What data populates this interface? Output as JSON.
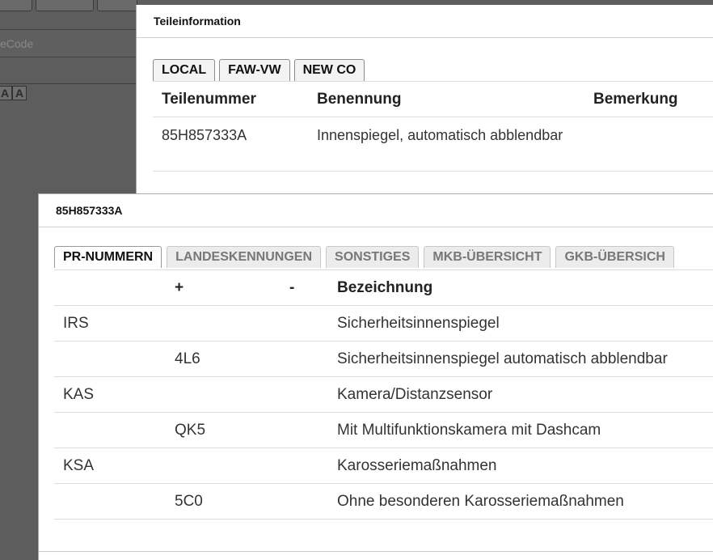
{
  "background": {
    "tabs": [
      "",
      "",
      "",
      "",
      "",
      ""
    ],
    "input_placeholder": "eCode",
    "font_increase": "A",
    "font_decrease": "A"
  },
  "dialog1": {
    "title": "Teileinformation",
    "tabs": [
      "LOCAL",
      "FAW-VW",
      "NEW CO"
    ],
    "columns": [
      "Teilenummer",
      "Benennung",
      "Bemerkung"
    ],
    "rows": [
      {
        "teilenummer": "85H857333A",
        "benennung": "Innenspiegel, automatisch abblendbar",
        "bemerkung": ""
      }
    ]
  },
  "dialog2": {
    "title": "85H857333A",
    "tabs": [
      "PR-NUMMERN",
      "LANDESKENNUNGEN",
      "SONSTIGES",
      "MKB-ÜBERSICHT",
      "GKB-ÜBERSICH"
    ],
    "columns": [
      "",
      "+",
      "-",
      "Bezeichnung"
    ],
    "rows": [
      {
        "group": "IRS",
        "plus": "",
        "minus": "",
        "bezeichnung": "Sicherheitsinnenspiegel"
      },
      {
        "group": "",
        "plus": "4L6",
        "minus": "",
        "bezeichnung": "Sicherheitsinnenspiegel automatisch abblendbar"
      },
      {
        "group": "KAS",
        "plus": "",
        "minus": "",
        "bezeichnung": "Kamera/Distanzsensor"
      },
      {
        "group": "",
        "plus": "QK5",
        "minus": "",
        "bezeichnung": "Mit Multifunktionskamera mit Dashcam"
      },
      {
        "group": "KSA",
        "plus": "",
        "minus": "",
        "bezeichnung": "Karosseriemaßnahmen"
      },
      {
        "group": "",
        "plus": "5C0",
        "minus": "",
        "bezeichnung": "Ohne besonderen Karosseriemaßnahmen"
      }
    ]
  }
}
